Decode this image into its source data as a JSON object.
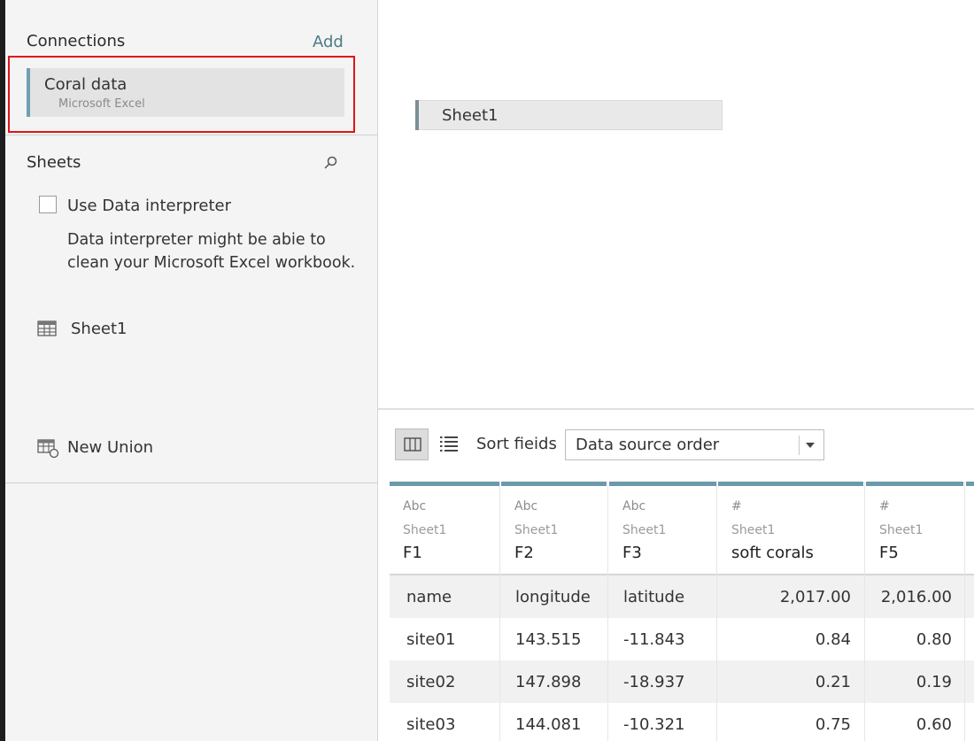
{
  "connections": {
    "title": "Connections",
    "add_label": "Add",
    "item": {
      "name": "Coral data",
      "type": "Microsoft Excel"
    }
  },
  "sheets": {
    "title": "Sheets",
    "interpreter": {
      "label": "Use Data interpreter",
      "description": "Data interpreter might be abie to clean your Microsoft Excel workbook."
    },
    "items": [
      {
        "label": "Sheet1"
      }
    ],
    "new_union_label": "New Union"
  },
  "canvas": {
    "sheet_label": "Sheet1"
  },
  "toolbar": {
    "sort_label": "Sort fieids",
    "sort_value": "Data source order"
  },
  "grid": {
    "columns": [
      {
        "type": "Abc",
        "source": "Sheet1",
        "name": "F1"
      },
      {
        "type": "Abc",
        "source": "Sheet1",
        "name": "F2"
      },
      {
        "type": "Abc",
        "source": "Sheet1",
        "name": "F3"
      },
      {
        "type": "#",
        "source": "Sheet1",
        "name": "soft corals"
      },
      {
        "type": "#",
        "source": "Sheet1",
        "name": "F5"
      }
    ],
    "rows": [
      [
        "name",
        "longitude",
        "latitude",
        "2,017.00",
        "2,016.00"
      ],
      [
        "site01",
        "143.515",
        "-11.843",
        "0.84",
        "0.80"
      ],
      [
        "site02",
        "147.898",
        "-18.937",
        "0.21",
        "0.19"
      ],
      [
        "site03",
        "144.081",
        "-10.321",
        "0.75",
        "0.60"
      ]
    ]
  },
  "colors": {
    "accent": "#6b9aa9",
    "highlight": "#e0131a",
    "link": "#4d7a84"
  }
}
